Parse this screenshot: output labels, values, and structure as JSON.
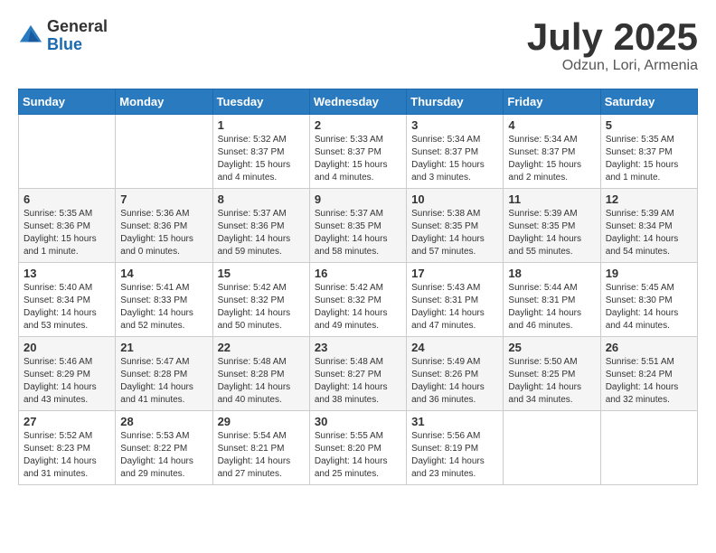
{
  "logo": {
    "general": "General",
    "blue": "Blue"
  },
  "title": "July 2025",
  "location": "Odzun, Lori, Armenia",
  "weekdays": [
    "Sunday",
    "Monday",
    "Tuesday",
    "Wednesday",
    "Thursday",
    "Friday",
    "Saturday"
  ],
  "weeks": [
    [
      {
        "day": "",
        "sunrise": "",
        "sunset": "",
        "daylight": ""
      },
      {
        "day": "",
        "sunrise": "",
        "sunset": "",
        "daylight": ""
      },
      {
        "day": "1",
        "sunrise": "Sunrise: 5:32 AM",
        "sunset": "Sunset: 8:37 PM",
        "daylight": "Daylight: 15 hours and 4 minutes."
      },
      {
        "day": "2",
        "sunrise": "Sunrise: 5:33 AM",
        "sunset": "Sunset: 8:37 PM",
        "daylight": "Daylight: 15 hours and 4 minutes."
      },
      {
        "day": "3",
        "sunrise": "Sunrise: 5:34 AM",
        "sunset": "Sunset: 8:37 PM",
        "daylight": "Daylight: 15 hours and 3 minutes."
      },
      {
        "day": "4",
        "sunrise": "Sunrise: 5:34 AM",
        "sunset": "Sunset: 8:37 PM",
        "daylight": "Daylight: 15 hours and 2 minutes."
      },
      {
        "day": "5",
        "sunrise": "Sunrise: 5:35 AM",
        "sunset": "Sunset: 8:37 PM",
        "daylight": "Daylight: 15 hours and 1 minute."
      }
    ],
    [
      {
        "day": "6",
        "sunrise": "Sunrise: 5:35 AM",
        "sunset": "Sunset: 8:36 PM",
        "daylight": "Daylight: 15 hours and 1 minute."
      },
      {
        "day": "7",
        "sunrise": "Sunrise: 5:36 AM",
        "sunset": "Sunset: 8:36 PM",
        "daylight": "Daylight: 15 hours and 0 minutes."
      },
      {
        "day": "8",
        "sunrise": "Sunrise: 5:37 AM",
        "sunset": "Sunset: 8:36 PM",
        "daylight": "Daylight: 14 hours and 59 minutes."
      },
      {
        "day": "9",
        "sunrise": "Sunrise: 5:37 AM",
        "sunset": "Sunset: 8:35 PM",
        "daylight": "Daylight: 14 hours and 58 minutes."
      },
      {
        "day": "10",
        "sunrise": "Sunrise: 5:38 AM",
        "sunset": "Sunset: 8:35 PM",
        "daylight": "Daylight: 14 hours and 57 minutes."
      },
      {
        "day": "11",
        "sunrise": "Sunrise: 5:39 AM",
        "sunset": "Sunset: 8:35 PM",
        "daylight": "Daylight: 14 hours and 55 minutes."
      },
      {
        "day": "12",
        "sunrise": "Sunrise: 5:39 AM",
        "sunset": "Sunset: 8:34 PM",
        "daylight": "Daylight: 14 hours and 54 minutes."
      }
    ],
    [
      {
        "day": "13",
        "sunrise": "Sunrise: 5:40 AM",
        "sunset": "Sunset: 8:34 PM",
        "daylight": "Daylight: 14 hours and 53 minutes."
      },
      {
        "day": "14",
        "sunrise": "Sunrise: 5:41 AM",
        "sunset": "Sunset: 8:33 PM",
        "daylight": "Daylight: 14 hours and 52 minutes."
      },
      {
        "day": "15",
        "sunrise": "Sunrise: 5:42 AM",
        "sunset": "Sunset: 8:32 PM",
        "daylight": "Daylight: 14 hours and 50 minutes."
      },
      {
        "day": "16",
        "sunrise": "Sunrise: 5:42 AM",
        "sunset": "Sunset: 8:32 PM",
        "daylight": "Daylight: 14 hours and 49 minutes."
      },
      {
        "day": "17",
        "sunrise": "Sunrise: 5:43 AM",
        "sunset": "Sunset: 8:31 PM",
        "daylight": "Daylight: 14 hours and 47 minutes."
      },
      {
        "day": "18",
        "sunrise": "Sunrise: 5:44 AM",
        "sunset": "Sunset: 8:31 PM",
        "daylight": "Daylight: 14 hours and 46 minutes."
      },
      {
        "day": "19",
        "sunrise": "Sunrise: 5:45 AM",
        "sunset": "Sunset: 8:30 PM",
        "daylight": "Daylight: 14 hours and 44 minutes."
      }
    ],
    [
      {
        "day": "20",
        "sunrise": "Sunrise: 5:46 AM",
        "sunset": "Sunset: 8:29 PM",
        "daylight": "Daylight: 14 hours and 43 minutes."
      },
      {
        "day": "21",
        "sunrise": "Sunrise: 5:47 AM",
        "sunset": "Sunset: 8:28 PM",
        "daylight": "Daylight: 14 hours and 41 minutes."
      },
      {
        "day": "22",
        "sunrise": "Sunrise: 5:48 AM",
        "sunset": "Sunset: 8:28 PM",
        "daylight": "Daylight: 14 hours and 40 minutes."
      },
      {
        "day": "23",
        "sunrise": "Sunrise: 5:48 AM",
        "sunset": "Sunset: 8:27 PM",
        "daylight": "Daylight: 14 hours and 38 minutes."
      },
      {
        "day": "24",
        "sunrise": "Sunrise: 5:49 AM",
        "sunset": "Sunset: 8:26 PM",
        "daylight": "Daylight: 14 hours and 36 minutes."
      },
      {
        "day": "25",
        "sunrise": "Sunrise: 5:50 AM",
        "sunset": "Sunset: 8:25 PM",
        "daylight": "Daylight: 14 hours and 34 minutes."
      },
      {
        "day": "26",
        "sunrise": "Sunrise: 5:51 AM",
        "sunset": "Sunset: 8:24 PM",
        "daylight": "Daylight: 14 hours and 32 minutes."
      }
    ],
    [
      {
        "day": "27",
        "sunrise": "Sunrise: 5:52 AM",
        "sunset": "Sunset: 8:23 PM",
        "daylight": "Daylight: 14 hours and 31 minutes."
      },
      {
        "day": "28",
        "sunrise": "Sunrise: 5:53 AM",
        "sunset": "Sunset: 8:22 PM",
        "daylight": "Daylight: 14 hours and 29 minutes."
      },
      {
        "day": "29",
        "sunrise": "Sunrise: 5:54 AM",
        "sunset": "Sunset: 8:21 PM",
        "daylight": "Daylight: 14 hours and 27 minutes."
      },
      {
        "day": "30",
        "sunrise": "Sunrise: 5:55 AM",
        "sunset": "Sunset: 8:20 PM",
        "daylight": "Daylight: 14 hours and 25 minutes."
      },
      {
        "day": "31",
        "sunrise": "Sunrise: 5:56 AM",
        "sunset": "Sunset: 8:19 PM",
        "daylight": "Daylight: 14 hours and 23 minutes."
      },
      {
        "day": "",
        "sunrise": "",
        "sunset": "",
        "daylight": ""
      },
      {
        "day": "",
        "sunrise": "",
        "sunset": "",
        "daylight": ""
      }
    ]
  ]
}
